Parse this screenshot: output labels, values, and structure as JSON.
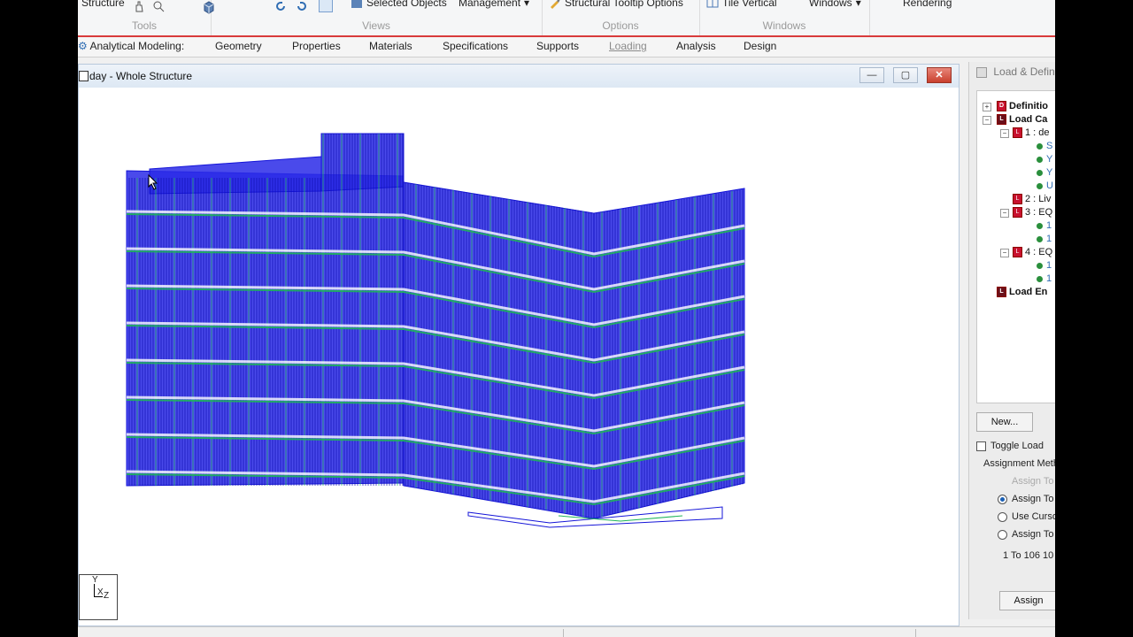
{
  "ribbon": {
    "structure_label": "Structure",
    "groups": {
      "tools": "Tools",
      "views": "Views",
      "options": "Options",
      "windows": "Windows"
    },
    "selected_objects": "Selected Objects",
    "management": "Management",
    "tooltip_options": "Structural Tooltip Options",
    "tile_vertical": "Tile Vertical",
    "windows_menu": "Windows",
    "rendering": "Rendering"
  },
  "menu": {
    "analytical_modeling": "Analytical Modeling:",
    "tabs": [
      "Geometry",
      "Properties",
      "Materials",
      "Specifications",
      "Supports",
      "Loading",
      "Analysis",
      "Design"
    ],
    "active_tab": "Loading"
  },
  "structure_window": {
    "title": "day - Whole Structure",
    "min_icon": "minimize-icon",
    "max_icon": "maximize-icon",
    "close_icon": "close-icon"
  },
  "triad": {
    "y": "Y",
    "x": "X",
    "z": "Z"
  },
  "load_panel": {
    "title": "Load & Defin",
    "tree": {
      "definitions": "Definitio",
      "load_cases": "Load Ca",
      "case1": "1 : de",
      "case2": "2 : Liv",
      "case3": "3 : EQ",
      "case4": "4 : EQ",
      "load_envelopes": "Load En",
      "sub_items": [
        "S",
        "Y",
        "Y",
        "U"
      ],
      "sub_items_3": [
        "1",
        "1"
      ],
      "sub_items_4": [
        "1",
        "1"
      ]
    },
    "new_button": "New...",
    "toggle_load": "Toggle Load",
    "assignment_method": "Assignment Meth",
    "options": [
      "Assign To",
      "Assign To",
      "Use Curso",
      "Assign To"
    ],
    "range_value": "1 To 106 10",
    "assign_button": "Assign"
  },
  "colors": {
    "frame_blue": "#1515d8",
    "load_green": "#1fb55a",
    "accent_red": "#d83b3b"
  }
}
